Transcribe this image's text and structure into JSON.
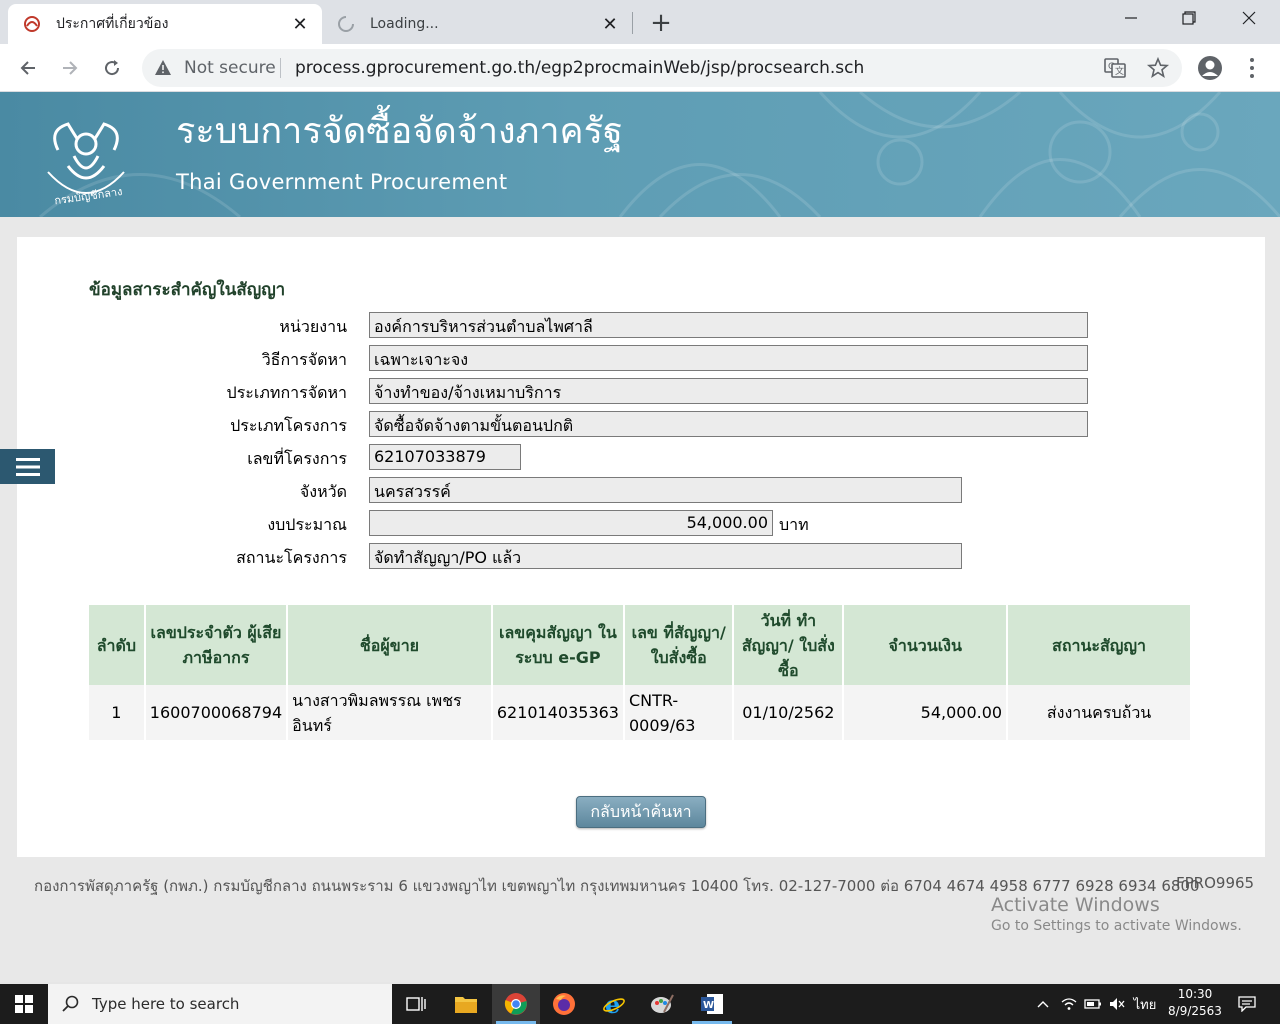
{
  "browser": {
    "tabs": [
      {
        "title": "ประกาศที่เกี่ยวข้อง",
        "active": true
      },
      {
        "title": "Loading...",
        "active": false
      }
    ],
    "security_label": "Not secure",
    "url": "process.gprocurement.go.th/egp2procmainWeb/jsp/procsearch.sch"
  },
  "banner": {
    "title_th": "ระบบการจัดซื้อจัดจ้างภาครัฐ",
    "title_en": "Thai Government Procurement",
    "logo_text": "กรมบัญชีกลาง"
  },
  "section": {
    "title": "ข้อมูลสาระสำคัญในสัญญา"
  },
  "fields": [
    {
      "label": "หน่วยงาน",
      "value": "องค์การบริหารส่วนตำบลไพศาลี"
    },
    {
      "label": "วิธีการจัดหา",
      "value": "เฉพาะเจาะจง"
    },
    {
      "label": "ประเภทการจัดหา",
      "value": "จ้างทำของ/จ้างเหมาบริการ"
    },
    {
      "label": "ประเภทโครงการ",
      "value": "จัดซื้อจัดจ้างตามขั้นตอนปกติ"
    },
    {
      "label": "เลขที่โครงการ",
      "value": "62107033879"
    },
    {
      "label": "จังหวัด",
      "value": "นครสวรรค์"
    },
    {
      "label": "งบประมาณ",
      "value": "54,000.00",
      "unit": "บาท"
    },
    {
      "label": "สถานะโครงการ",
      "value": "จัดทำสัญญา/PO แล้ว"
    }
  ],
  "table": {
    "headers": [
      "ลำดับ",
      "เลขประจำตัว ผู้เสียภาษีอากร",
      "ชื่อผู้ขาย",
      "เลขคุมสัญญา ในระบบ e-GP",
      "เลข ที่สัญญา/ ใบสั่งซื้อ",
      "วันที่ ทำสัญญา/ ใบสั่งซื้อ",
      "จำนวนเงิน",
      "สถานะสัญญา"
    ],
    "rows": [
      [
        "1",
        "1600700068794",
        "นางสาวพิมลพรรณ เพชรอินทร์",
        "621014035363",
        "CNTR-0009/63",
        "01/10/2562",
        "54,000.00",
        "ส่งงานครบถ้วน"
      ]
    ]
  },
  "back_button": "กลับหน้าค้นหา",
  "footer": {
    "address": "กองการพัสดุภาครัฐ (กพภ.) กรมบัญชีกลาง ถนนพระราม 6 แขวงพญาไท เขตพญาไท กรุงเทพมหานคร 10400 โทร. 02-127-7000 ต่อ 6704 4674 4958 6777 6928 6934 6800",
    "code": "FPRO9965"
  },
  "watermark": {
    "line1": "Activate Windows",
    "line2": "Go to Settings to activate Windows."
  },
  "taskbar": {
    "search_placeholder": "Type here to search",
    "language": "ไทย",
    "time": "10:30",
    "date": "8/9/2563"
  },
  "colors": {
    "banner": "#5e9db4",
    "table_header_bg": "#d4e7d4",
    "table_header_text": "#1f4a2c",
    "section_title": "#21422b",
    "button": "#6d93a8"
  }
}
